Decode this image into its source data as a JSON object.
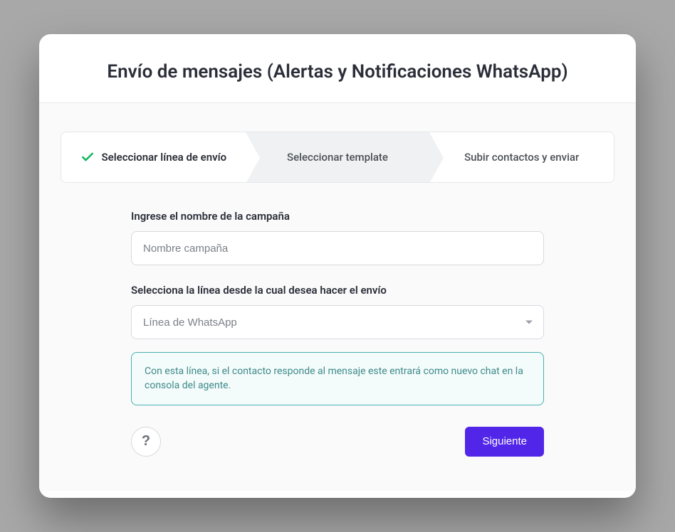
{
  "header": {
    "title": "Envío de mensajes (Alertas y Notificaciones WhatsApp)"
  },
  "stepper": {
    "steps": [
      {
        "label": "Seleccionar línea de envío",
        "completed": true
      },
      {
        "label": "Seleccionar template",
        "active": true
      },
      {
        "label": "Subir contactos y enviar"
      }
    ]
  },
  "form": {
    "campaign_label": "Ingrese el nombre de la campaña",
    "campaign_placeholder": "Nombre campaña",
    "line_label": "Selecciona la línea desde la cual desea hacer el envío",
    "line_placeholder": "Línea de WhatsApp",
    "info_text": "Con esta línea, si el contacto responde al mensaje este entrará como nuevo chat en la consola del agente."
  },
  "footer": {
    "help_label": "?",
    "next_label": "Siguiente"
  }
}
